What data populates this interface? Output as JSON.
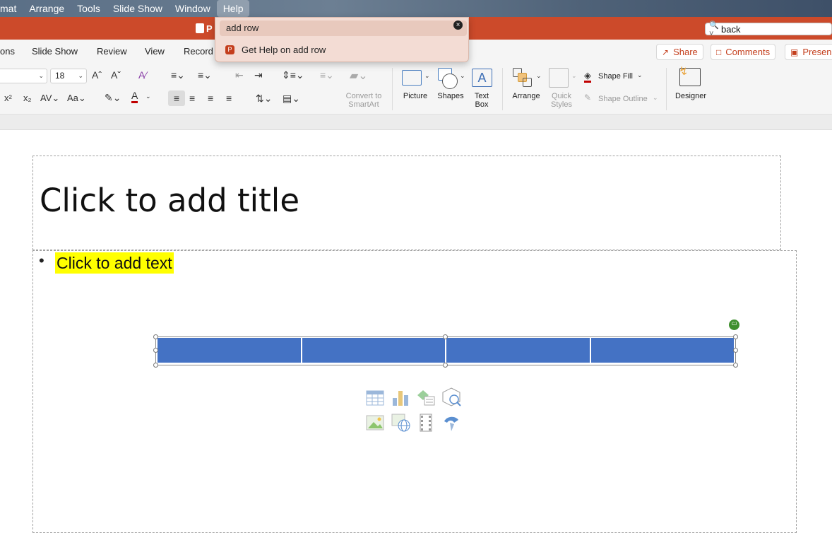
{
  "menubar": {
    "items": [
      "mat",
      "Arrange",
      "Tools",
      "Slide Show",
      "Window",
      "Help"
    ],
    "active": "Help"
  },
  "titlebar": {
    "doc_title": "P",
    "search_value": "back"
  },
  "help_menu": {
    "query": "add row",
    "result": "Get Help on add row"
  },
  "ribbon": {
    "tabs": [
      "ons",
      "Slide Show",
      "Review",
      "View",
      "Record"
    ],
    "share_label": "Share",
    "comments_label": "Comments",
    "present_label": "Presen",
    "font_size": "18",
    "convert_label_1": "Convert to",
    "convert_label_2": "SmartArt",
    "picture_label": "Picture",
    "shapes_label": "Shapes",
    "textbox_label_1": "Text",
    "textbox_label_2": "Box",
    "arrange_label": "Arrange",
    "quick_styles_1": "Quick",
    "quick_styles_2": "Styles",
    "shape_fill": "Shape Fill",
    "shape_outline": "Shape Outline",
    "designer_label": "Designer"
  },
  "slide": {
    "title_placeholder": "Click to add title",
    "body_placeholder": "Click to add text",
    "bullet": "•",
    "table_columns": 4,
    "rotate_badge": "CJ"
  },
  "colors": {
    "accent": "#cc4a2a",
    "table_fill": "#4472c4",
    "highlight": "#ffff00"
  }
}
